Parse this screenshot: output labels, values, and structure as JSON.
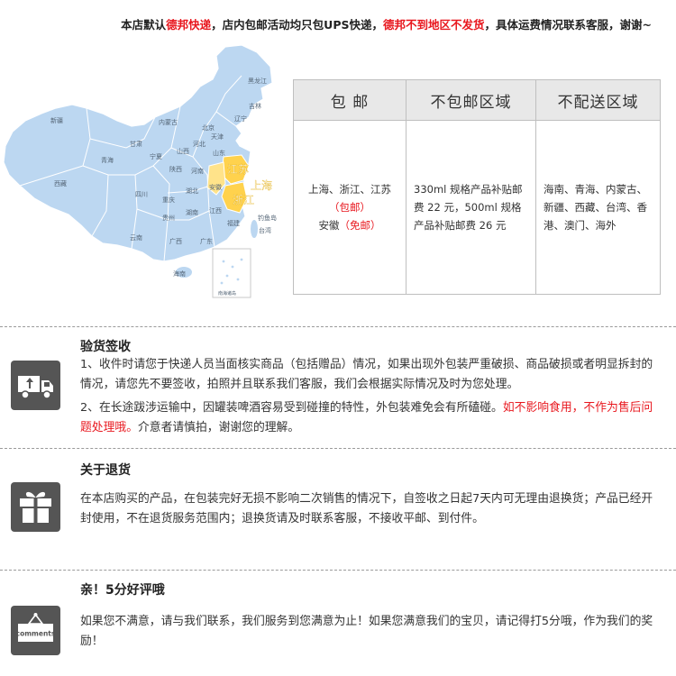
{
  "notice": {
    "part1": "本店默认",
    "courier": "德邦快递",
    "part2": "，店内包邮活动均只包UPS快递，",
    "warning": "德邦不到地区不发货",
    "part3": "，具体运费情况联系客服，谢谢~"
  },
  "map": {
    "provinces": [
      "黑龙江",
      "吉林",
      "辽宁",
      "内蒙古",
      "新疆",
      "北京",
      "天津",
      "河北",
      "山西",
      "宁夏",
      "甘肃",
      "青海",
      "山东",
      "陕西",
      "河南",
      "西藏",
      "四川",
      "湖北",
      "安徽",
      "重庆",
      "湖南",
      "江西",
      "贵州",
      "云南",
      "广西",
      "广东",
      "福建",
      "台湾",
      "海南"
    ],
    "highlight_jiangsu": "江苏",
    "highlight_shanghai": "上海",
    "highlight_zhejiang": "浙江",
    "diaoyu": "钓鱼岛",
    "south_sea": "南海诸岛"
  },
  "shipping_table": {
    "headers": [
      "包 邮",
      "不包邮区域",
      "不配送区域"
    ],
    "free": {
      "line1": "上海、浙江、江苏",
      "line1_tag": "（包邮）",
      "line2": "安徽",
      "line2_tag": "（免邮）"
    },
    "not_free": "330ml 规格产品补贴邮费 22 元，500ml 规格产品补贴邮费 26 元",
    "no_delivery": "海南、青海、内蒙古、新疆、西藏、台湾、香港、澳门、海外"
  },
  "sections": {
    "inspection": {
      "title": "验货签收",
      "p1": "1、收件时请您于快递人员当面核实商品（包括赠品）情况，如果出现外包装严重破损、商品破损或者明显拆封的情况，请您先不要签收，拍照并且联系我们客服，我们会根据实际情况及时为您处理。",
      "p2_main": "2、在长途跋涉运输中，因罐装啤酒容易受到碰撞的特性，外包装难免会有所磕碰。",
      "p2_red": "如不影响食用，不作为售后问题处理哦。",
      "p2_end": "介意者请慎拍，谢谢您的理解。"
    },
    "returns": {
      "title": "关于退货",
      "text": "在本店购买的产品，在包装完好无损不影响二次销售的情况下，自签收之日起7天内可无理由退换货；产品已经开封使用，不在退货服务范围内；退换货请及时联系客服，不接收平邮、到付件。"
    },
    "review": {
      "title": "亲！5分好评哦",
      "text": "如果您不满意，请与我们联系，我们服务到您满意为止！如果您满意我们的宝贝，请记得打5分哦，作为我们的奖励！",
      "icon_label": "comments"
    }
  }
}
